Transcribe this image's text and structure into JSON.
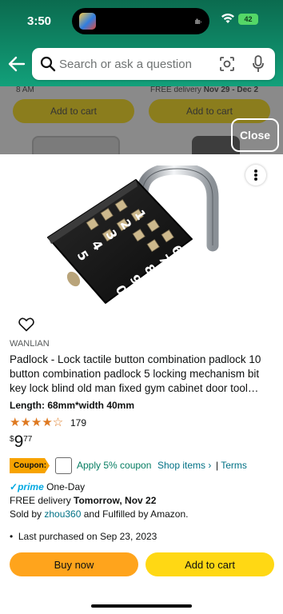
{
  "status_bar": {
    "time": "3:50",
    "battery": "42"
  },
  "search": {
    "placeholder": "Search or ask a question"
  },
  "background_page": {
    "left_text": "8 AM",
    "right_text_prefix": "FREE delivery ",
    "right_text_bold": "Nov 29 - Dec 2",
    "add_to_cart_left": "Add to cart",
    "add_to_cart_right": "Add to cart"
  },
  "close_label": "Close",
  "product": {
    "brand": "WANLIAN",
    "title": "Padlock - Lock tactile button combination padlock 10 button combination padlock 5 locking mechanism bit key lock blind old man fixed gym cabinet door tool holder",
    "size_label": "Length: 68mm*width 40mm",
    "rating": 4.5,
    "rating_stars": "★★★★☆",
    "review_count": "179",
    "price": {
      "currency": "$",
      "whole": "9",
      "fraction": "77"
    },
    "coupon": {
      "tag": "Coupon:",
      "text": "Apply 5% coupon",
      "shop_items": "Shop items ›",
      "separator": "|",
      "terms": "Terms"
    },
    "prime": {
      "check": "✓",
      "word": "prime",
      "one_day": "One-Day"
    },
    "delivery": {
      "prefix": "FREE delivery ",
      "date": "Tomorrow, Nov 22"
    },
    "sold_by": {
      "prefix": "Sold by ",
      "seller": "zhou360",
      "suffix": " and Fulfilled by Amazon."
    },
    "last_purchased": "Last purchased on Sep 23, 2023",
    "buy_now": "Buy now",
    "add_to_cart": "Add to cart",
    "keypad_digits": [
      "1",
      "2",
      "3",
      "4",
      "5",
      "6",
      "7",
      "8",
      "9",
      "0"
    ]
  },
  "colors": {
    "header_green": "#0b6b4f",
    "buy_now": "#ffa41c",
    "add_to_cart": "#ffd814",
    "link": "#007185",
    "coupon_green": "#067d62",
    "star": "#de7921"
  },
  "icons": [
    "back-arrow-icon",
    "search-icon",
    "camera-lens-icon",
    "microphone-icon",
    "more-options-icon",
    "heart-icon",
    "wifi-icon",
    "battery-icon"
  ]
}
